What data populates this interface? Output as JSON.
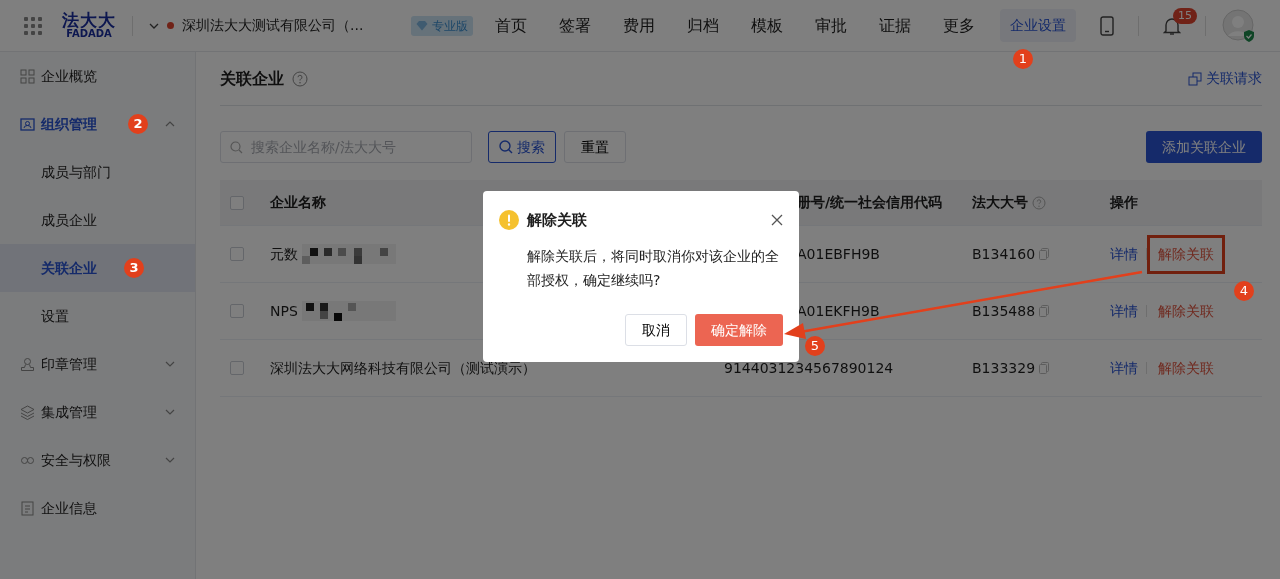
{
  "header": {
    "logo": {
      "top": "法大大",
      "bottom": "FADADA"
    },
    "company": "深圳法大大测试有限公司（...",
    "edition": "专业版",
    "nav": [
      {
        "label": "首页",
        "selected": false
      },
      {
        "label": "签署",
        "selected": false
      },
      {
        "label": "费用",
        "selected": false
      },
      {
        "label": "归档",
        "selected": false
      },
      {
        "label": "模板",
        "selected": false
      },
      {
        "label": "审批",
        "selected": false
      },
      {
        "label": "证据",
        "selected": false
      },
      {
        "label": "更多",
        "selected": false
      }
    ],
    "settings": {
      "label": "企业设置",
      "selected": true,
      "step": "1"
    },
    "notifications": "15"
  },
  "sidebar": {
    "items": [
      {
        "label": "企业概览",
        "selected": false
      },
      {
        "label": "组织管理",
        "selected": true,
        "expanded": true,
        "step": "2",
        "children": [
          {
            "label": "成员与部门",
            "selected": false
          },
          {
            "label": "成员企业",
            "selected": false
          },
          {
            "label": "关联企业",
            "selected": true,
            "step": "3"
          },
          {
            "label": "设置",
            "selected": false
          }
        ]
      },
      {
        "label": "印章管理",
        "selected": false,
        "expanded": false
      },
      {
        "label": "集成管理",
        "selected": false,
        "expanded": false
      },
      {
        "label": "安全与权限",
        "selected": false,
        "expanded": false
      },
      {
        "label": "企业信息",
        "selected": false
      }
    ]
  },
  "page": {
    "title": "关联企业",
    "request_link": "关联请求",
    "search": {
      "placeholder": "搜索企业名称/法大大号"
    },
    "search_button": "搜索",
    "reset_button": "重置",
    "add_button": "添加关联企业"
  },
  "table": {
    "header_checked": false,
    "columns": [
      "企业名称",
      "册号/统一社会信用代码",
      "法大大号",
      "操作"
    ],
    "rows": [
      {
        "checked": false,
        "name": "元数",
        "redacted": true,
        "code": "A01EBFH9B",
        "code_covered": true,
        "number": "B134160",
        "actions": [
          "详情",
          "解除关联"
        ],
        "highlighted": true,
        "step": "4"
      },
      {
        "checked": false,
        "name": "NPS",
        "redacted": true,
        "code": "A01EKFH9B",
        "code_covered": true,
        "number": "B135488",
        "actions": [
          "详情",
          "解除关联"
        ],
        "highlighted": false
      },
      {
        "checked": false,
        "name": "深圳法大大网络科技有限公司（测试演示）",
        "redacted": false,
        "code": "9144031234567890124",
        "code_covered": false,
        "number": "B133329",
        "actions": [
          "详情",
          "解除关联"
        ],
        "highlighted": false
      }
    ]
  },
  "dialog": {
    "title": "解除关联",
    "message": "解除关联后，将同时取消你对该企业的全部授权，确定继续吗?",
    "cancel": "取消",
    "confirm": "确定解除",
    "confirm_step": "5"
  }
}
